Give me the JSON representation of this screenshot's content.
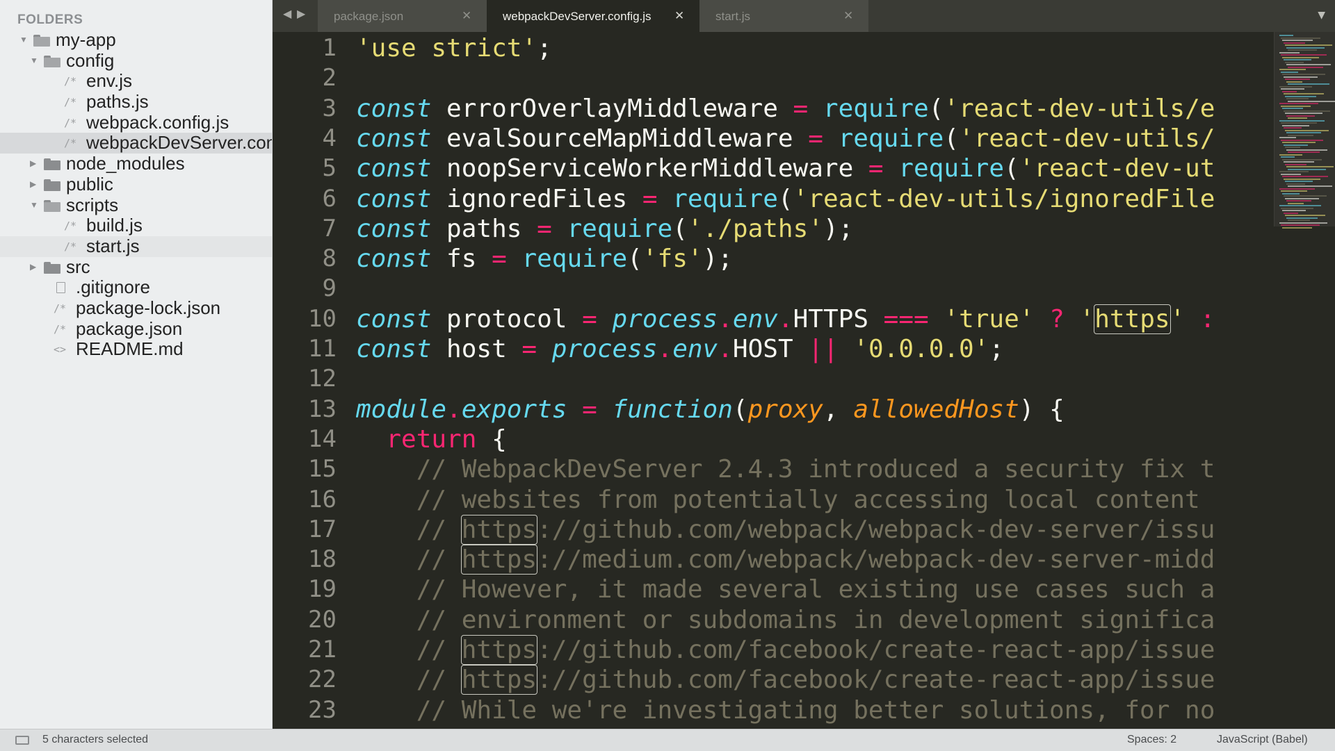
{
  "sidebar": {
    "header": "FOLDERS",
    "items": [
      {
        "label": "my-app",
        "kind": "folder-open",
        "depth": 0
      },
      {
        "label": "config",
        "kind": "folder-open",
        "depth": 1
      },
      {
        "label": "env.js",
        "kind": "file-js",
        "depth": 2
      },
      {
        "label": "paths.js",
        "kind": "file-js",
        "depth": 2
      },
      {
        "label": "webpack.config.js",
        "kind": "file-js",
        "depth": 2
      },
      {
        "label": "webpackDevServer.config.js",
        "kind": "file-js",
        "depth": 2,
        "selected": true
      },
      {
        "label": "node_modules",
        "kind": "folder-closed",
        "depth": 1
      },
      {
        "label": "public",
        "kind": "folder-closed",
        "depth": 1
      },
      {
        "label": "scripts",
        "kind": "folder-open",
        "depth": 1
      },
      {
        "label": "build.js",
        "kind": "file-js",
        "depth": 2
      },
      {
        "label": "start.js",
        "kind": "file-js",
        "depth": 2,
        "hover": true
      },
      {
        "label": "src",
        "kind": "folder-closed",
        "depth": 1
      },
      {
        "label": ".gitignore",
        "kind": "file-plain",
        "depth": 1
      },
      {
        "label": "package-lock.json",
        "kind": "file-js",
        "depth": 1
      },
      {
        "label": "package.json",
        "kind": "file-js",
        "depth": 1
      },
      {
        "label": "README.md",
        "kind": "file-md",
        "depth": 1
      }
    ]
  },
  "tabs": [
    {
      "label": "package.json",
      "active": false
    },
    {
      "label": "webpackDevServer.config.js",
      "active": true
    },
    {
      "label": "start.js",
      "active": false
    }
  ],
  "icons": {
    "nav_back": "◀",
    "nav_forward": "▶",
    "tab_close": "✕",
    "tabs_menu": "▼",
    "arrow_open": "▼",
    "arrow_closed": "▶",
    "file_js": "/*",
    "file_md": "<>"
  },
  "editor": {
    "lines": [
      {
        "n": "1",
        "tokens": [
          {
            "t": "'use strict'",
            "c": "str"
          },
          {
            "t": ";",
            "c": "plain"
          }
        ]
      },
      {
        "n": "2",
        "tokens": []
      },
      {
        "n": "3",
        "tokens": [
          {
            "t": "const",
            "c": "kw"
          },
          {
            "t": " errorOverlayMiddleware ",
            "c": "plain"
          },
          {
            "t": "=",
            "c": "op"
          },
          {
            "t": " ",
            "c": "plain"
          },
          {
            "t": "require",
            "c": "fn"
          },
          {
            "t": "(",
            "c": "plain"
          },
          {
            "t": "'react-dev-utils/e",
            "c": "str"
          }
        ]
      },
      {
        "n": "4",
        "tokens": [
          {
            "t": "const",
            "c": "kw"
          },
          {
            "t": " evalSourceMapMiddleware ",
            "c": "plain"
          },
          {
            "t": "=",
            "c": "op"
          },
          {
            "t": " ",
            "c": "plain"
          },
          {
            "t": "require",
            "c": "fn"
          },
          {
            "t": "(",
            "c": "plain"
          },
          {
            "t": "'react-dev-utils/",
            "c": "str"
          }
        ]
      },
      {
        "n": "5",
        "tokens": [
          {
            "t": "const",
            "c": "kw"
          },
          {
            "t": " noopServiceWorkerMiddleware ",
            "c": "plain"
          },
          {
            "t": "=",
            "c": "op"
          },
          {
            "t": " ",
            "c": "plain"
          },
          {
            "t": "require",
            "c": "fn"
          },
          {
            "t": "(",
            "c": "plain"
          },
          {
            "t": "'react-dev-ut",
            "c": "str"
          }
        ]
      },
      {
        "n": "6",
        "tokens": [
          {
            "t": "const",
            "c": "kw"
          },
          {
            "t": " ignoredFiles ",
            "c": "plain"
          },
          {
            "t": "=",
            "c": "op"
          },
          {
            "t": " ",
            "c": "plain"
          },
          {
            "t": "require",
            "c": "fn"
          },
          {
            "t": "(",
            "c": "plain"
          },
          {
            "t": "'react-dev-utils/ignoredFile",
            "c": "str"
          }
        ]
      },
      {
        "n": "7",
        "tokens": [
          {
            "t": "const",
            "c": "kw"
          },
          {
            "t": " paths ",
            "c": "plain"
          },
          {
            "t": "=",
            "c": "op"
          },
          {
            "t": " ",
            "c": "plain"
          },
          {
            "t": "require",
            "c": "fn"
          },
          {
            "t": "(",
            "c": "plain"
          },
          {
            "t": "'./paths'",
            "c": "str"
          },
          {
            "t": ");",
            "c": "plain"
          }
        ]
      },
      {
        "n": "8",
        "tokens": [
          {
            "t": "const",
            "c": "kw"
          },
          {
            "t": " fs ",
            "c": "plain"
          },
          {
            "t": "=",
            "c": "op"
          },
          {
            "t": " ",
            "c": "plain"
          },
          {
            "t": "require",
            "c": "fn"
          },
          {
            "t": "(",
            "c": "plain"
          },
          {
            "t": "'fs'",
            "c": "str"
          },
          {
            "t": ");",
            "c": "plain"
          }
        ]
      },
      {
        "n": "9",
        "tokens": []
      },
      {
        "n": "10",
        "tokens": [
          {
            "t": "const",
            "c": "kw"
          },
          {
            "t": " protocol ",
            "c": "plain"
          },
          {
            "t": "=",
            "c": "op"
          },
          {
            "t": " ",
            "c": "plain"
          },
          {
            "t": "process",
            "c": "kw"
          },
          {
            "t": ".",
            "c": "op"
          },
          {
            "t": "env",
            "c": "kw"
          },
          {
            "t": ".",
            "c": "op"
          },
          {
            "t": "HTTPS ",
            "c": "plain"
          },
          {
            "t": "===",
            "c": "op"
          },
          {
            "t": " ",
            "c": "plain"
          },
          {
            "t": "'true'",
            "c": "str"
          },
          {
            "t": " ",
            "c": "plain"
          },
          {
            "t": "?",
            "c": "op"
          },
          {
            "t": " ",
            "c": "plain"
          },
          {
            "t": "'",
            "c": "str"
          },
          {
            "t": "https",
            "c": "str",
            "box": true
          },
          {
            "t": "'",
            "c": "str"
          },
          {
            "t": " :",
            "c": "op"
          }
        ]
      },
      {
        "n": "11",
        "tokens": [
          {
            "t": "const",
            "c": "kw"
          },
          {
            "t": " host ",
            "c": "plain"
          },
          {
            "t": "=",
            "c": "op"
          },
          {
            "t": " ",
            "c": "plain"
          },
          {
            "t": "process",
            "c": "kw"
          },
          {
            "t": ".",
            "c": "op"
          },
          {
            "t": "env",
            "c": "kw"
          },
          {
            "t": ".",
            "c": "op"
          },
          {
            "t": "HOST ",
            "c": "plain"
          },
          {
            "t": "||",
            "c": "op"
          },
          {
            "t": " ",
            "c": "plain"
          },
          {
            "t": "'0.0.0.0'",
            "c": "str"
          },
          {
            "t": ";",
            "c": "plain"
          }
        ]
      },
      {
        "n": "12",
        "tokens": []
      },
      {
        "n": "13",
        "tokens": [
          {
            "t": "module",
            "c": "kw"
          },
          {
            "t": ".",
            "c": "op"
          },
          {
            "t": "exports",
            "c": "kw"
          },
          {
            "t": " ",
            "c": "plain"
          },
          {
            "t": "=",
            "c": "op"
          },
          {
            "t": " ",
            "c": "plain"
          },
          {
            "t": "function",
            "c": "kw"
          },
          {
            "t": "(",
            "c": "plain"
          },
          {
            "t": "proxy",
            "c": "param"
          },
          {
            "t": ", ",
            "c": "plain"
          },
          {
            "t": "allowedHost",
            "c": "param"
          },
          {
            "t": ") {",
            "c": "plain"
          }
        ]
      },
      {
        "n": "14",
        "tokens": [
          {
            "t": "  ",
            "c": "plain"
          },
          {
            "t": "return",
            "c": "ret"
          },
          {
            "t": " {",
            "c": "plain"
          }
        ]
      },
      {
        "n": "15",
        "tokens": [
          {
            "t": "    // WebpackDevServer 2.4.3 introduced a security fix t",
            "c": "com"
          }
        ]
      },
      {
        "n": "16",
        "tokens": [
          {
            "t": "    // websites from potentially accessing local content",
            "c": "com"
          }
        ]
      },
      {
        "n": "17",
        "tokens": [
          {
            "t": "    // ",
            "c": "com"
          },
          {
            "t": "https",
            "c": "com",
            "box": true
          },
          {
            "t": "://github.com/webpack/webpack-dev-server/issu",
            "c": "com"
          }
        ]
      },
      {
        "n": "18",
        "tokens": [
          {
            "t": "    // ",
            "c": "com"
          },
          {
            "t": "https",
            "c": "com",
            "box": true
          },
          {
            "t": "://medium.com/webpack/webpack-dev-server-midd",
            "c": "com"
          }
        ]
      },
      {
        "n": "19",
        "tokens": [
          {
            "t": "    // However, it made several existing use cases such a",
            "c": "com"
          }
        ]
      },
      {
        "n": "20",
        "tokens": [
          {
            "t": "    // environment or subdomains in development significa",
            "c": "com"
          }
        ]
      },
      {
        "n": "21",
        "tokens": [
          {
            "t": "    // ",
            "c": "com"
          },
          {
            "t": "https",
            "c": "com",
            "box": true
          },
          {
            "t": "://github.com/facebook/create-react-app/issue",
            "c": "com"
          }
        ]
      },
      {
        "n": "22",
        "tokens": [
          {
            "t": "    // ",
            "c": "com"
          },
          {
            "t": "https",
            "c": "com",
            "box": true
          },
          {
            "t": "://github.com/facebook/create-react-app/issue",
            "c": "com"
          }
        ]
      },
      {
        "n": "23",
        "tokens": [
          {
            "t": "    // While we're investigating better solutions, for no",
            "c": "com"
          }
        ]
      }
    ]
  },
  "statusbar": {
    "selection": "5 characters selected",
    "spaces": "Spaces: 2",
    "syntax": "JavaScript (Babel)"
  }
}
